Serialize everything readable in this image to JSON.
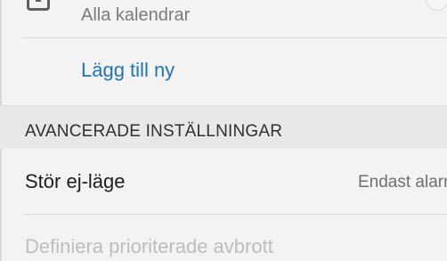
{
  "calendar": {
    "label": "Alla kalendrar",
    "icon": "checkbox-icon",
    "toggle_state": "off"
  },
  "add_new": {
    "label": "Lägg till ny",
    "color": "#1f73b7"
  },
  "advanced": {
    "title": "AVANCERADE INSTÄLLNINGAR"
  },
  "do_not_disturb": {
    "label": "Stör ej-läge",
    "value": "Endast alarm"
  },
  "priority": {
    "label": "Definiera prioriterade avbrott",
    "enabled": false
  }
}
